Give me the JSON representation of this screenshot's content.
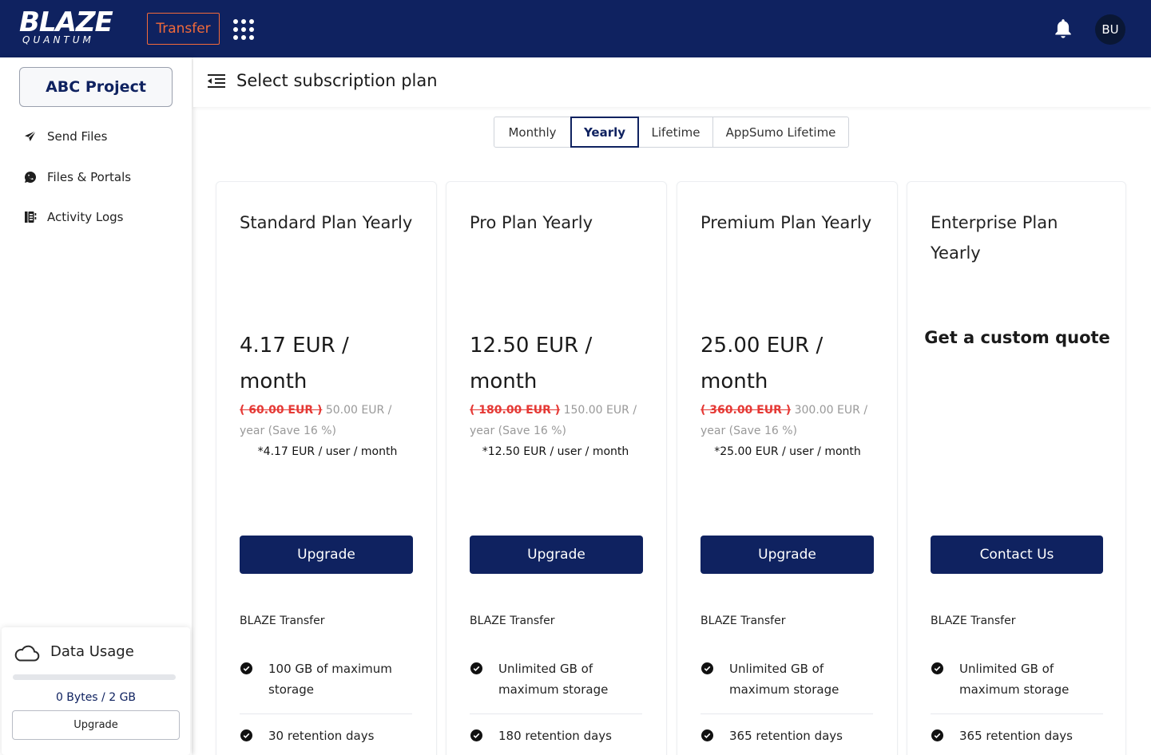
{
  "app": {
    "logo_main": "BLAZE",
    "logo_sub": "QUANTUM",
    "transfer_label": "Transfer",
    "avatar_initials": "BU"
  },
  "sidebar": {
    "project_label": "ABC Project",
    "items": [
      {
        "label": "Send Files",
        "icon": "send-icon"
      },
      {
        "label": "Files & Portals",
        "icon": "portal-icon"
      },
      {
        "label": "Activity Logs",
        "icon": "activity-log-icon"
      }
    ],
    "usage": {
      "title": "Data Usage",
      "value_text": "0 Bytes / 2 GB",
      "fraction": 0,
      "upgrade_label": "Upgrade"
    }
  },
  "header": {
    "title": "Select subscription plan"
  },
  "tabs": [
    {
      "label": "Monthly",
      "active": false
    },
    {
      "label": "Yearly",
      "active": true
    },
    {
      "label": "Lifetime",
      "active": false
    },
    {
      "label": "AppSumo Lifetime",
      "active": false
    }
  ],
  "plans": [
    {
      "name": "Standard Plan Yearly",
      "price": "4.17 EUR / month",
      "old_price": "( 60.00 EUR )",
      "new_price": " 50.00 EUR / year (Save 16 %)",
      "per_user": "*4.17 EUR / user / month",
      "button": "Upgrade",
      "feature_head": "BLAZE Transfer",
      "features": [
        "100 GB of maximum storage",
        "30 retention days"
      ]
    },
    {
      "name": "Pro Plan Yearly",
      "price": "12.50 EUR / month",
      "old_price": "( 180.00 EUR )",
      "new_price": " 150.00 EUR / year (Save 16 %)",
      "per_user": "*12.50 EUR / user / month",
      "button": "Upgrade",
      "feature_head": "BLAZE Transfer",
      "features": [
        "Unlimited GB of maximum storage",
        "180 retention days"
      ]
    },
    {
      "name": "Premium Plan Yearly",
      "price": "25.00 EUR / month",
      "old_price": "( 360.00 EUR )",
      "new_price": " 300.00 EUR / year (Save 16 %)",
      "per_user": "*25.00 EUR / user / month",
      "button": "Upgrade",
      "feature_head": "BLAZE Transfer",
      "features": [
        "Unlimited GB of maximum storage",
        "365 retention days"
      ]
    },
    {
      "name": "Enterprise Plan Yearly",
      "quote": "Get a custom quote",
      "button": "Contact Us",
      "feature_head": "BLAZE Transfer",
      "features": [
        "Unlimited GB of maximum storage",
        "365 retention days"
      ]
    }
  ],
  "colors": {
    "brand_navy": "#0f2260",
    "accent_orange": "#f26a3a",
    "strike_red": "#e53935"
  }
}
